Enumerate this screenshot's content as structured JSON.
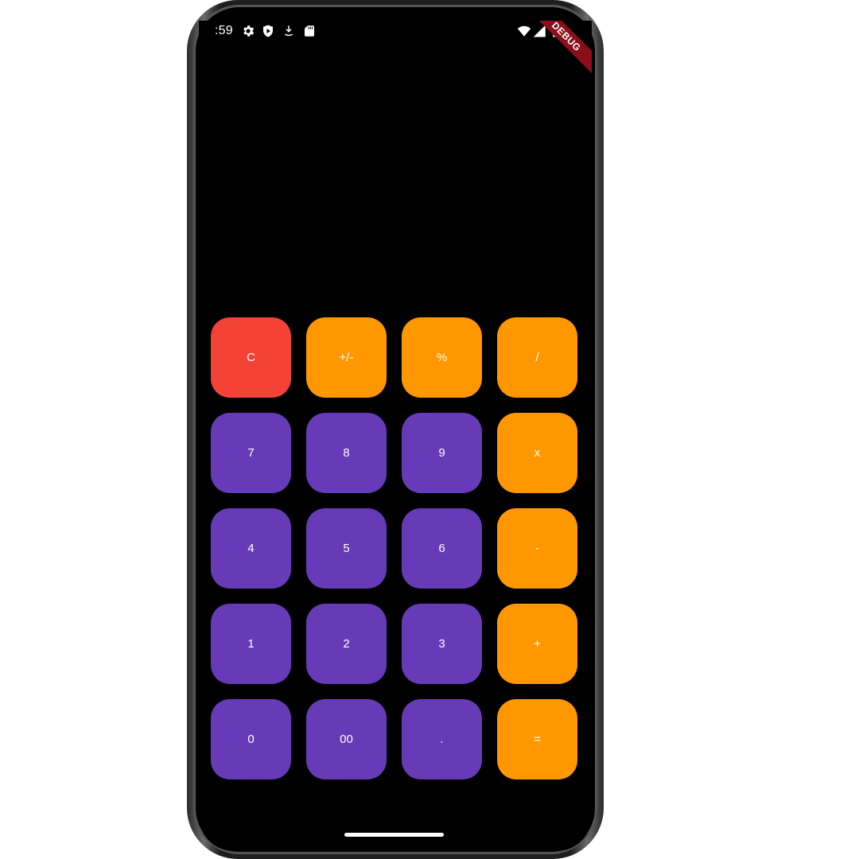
{
  "status_bar": {
    "time": ":59",
    "left_icons": [
      "gear-icon",
      "shield-play-icon",
      "download-icon",
      "sd-card-icon"
    ],
    "right_icons": [
      "wifi-icon",
      "signal-icon",
      "battery-icon"
    ],
    "debug_label": "DEBUG"
  },
  "colors": {
    "clear": "#f44336",
    "operator": "#ff9800",
    "digit": "#673ab7",
    "background": "#000000"
  },
  "keypad": {
    "rows": [
      [
        {
          "label": "C",
          "kind": "clear"
        },
        {
          "label": "+/-",
          "kind": "operator"
        },
        {
          "label": "%",
          "kind": "operator"
        },
        {
          "label": "/",
          "kind": "operator"
        }
      ],
      [
        {
          "label": "7",
          "kind": "digit"
        },
        {
          "label": "8",
          "kind": "digit"
        },
        {
          "label": "9",
          "kind": "digit"
        },
        {
          "label": "x",
          "kind": "operator"
        }
      ],
      [
        {
          "label": "4",
          "kind": "digit"
        },
        {
          "label": "5",
          "kind": "digit"
        },
        {
          "label": "6",
          "kind": "digit"
        },
        {
          "label": "-",
          "kind": "operator"
        }
      ],
      [
        {
          "label": "1",
          "kind": "digit"
        },
        {
          "label": "2",
          "kind": "digit"
        },
        {
          "label": "3",
          "kind": "digit"
        },
        {
          "label": "+",
          "kind": "operator"
        }
      ],
      [
        {
          "label": "0",
          "kind": "digit"
        },
        {
          "label": "00",
          "kind": "digit"
        },
        {
          "label": ".",
          "kind": "digit"
        },
        {
          "label": "=",
          "kind": "operator"
        }
      ]
    ]
  }
}
